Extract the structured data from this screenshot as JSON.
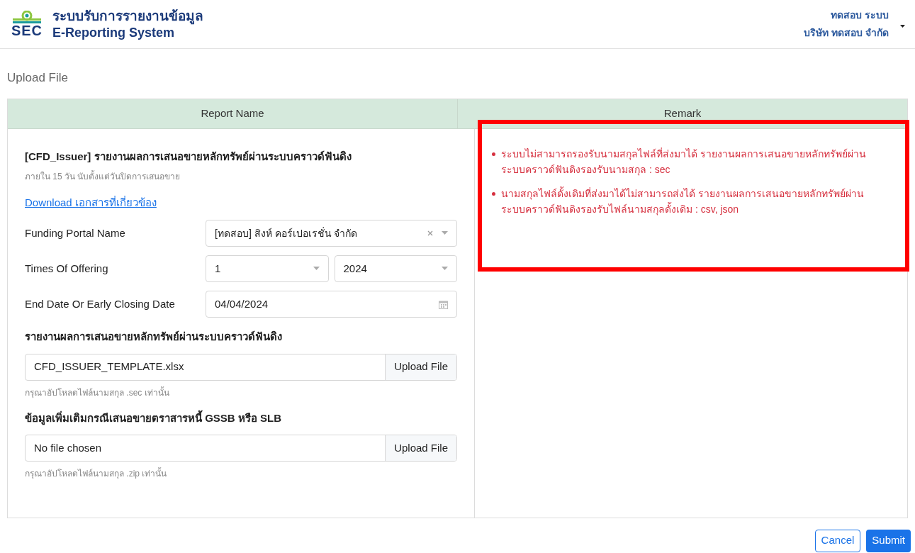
{
  "header": {
    "logo_text": "SEC",
    "title_th": "ระบบรับการรายงานข้อมูล",
    "title_en": "E-Reporting System",
    "user_name": "ทดสอบ ระบบ",
    "company": "บริษัท ทดสอบ จำกัด"
  },
  "page_title": "Upload File",
  "table": {
    "columns": [
      "Report Name",
      "Remark"
    ],
    "report": {
      "title": "[CFD_Issuer] รายงานผลการเสนอขายหลักทรัพย์ผ่านระบบคราวด์ฟันดิง",
      "subtitle": "ภายใน 15 วัน นับตั้งแต่วันปิดการเสนอขาย",
      "download_link": "Download เอกสารที่เกี่ยวข้อง",
      "fields": [
        {
          "kind": "select",
          "label": "Funding Portal Name",
          "value": "[ทดสอบ] สิงห์ คอร์เปอเรชั่น จำกัด",
          "clearable": true
        },
        {
          "kind": "select_pair",
          "label": "Times Of Offering",
          "values": [
            "1",
            "2024"
          ]
        },
        {
          "kind": "date",
          "label": "End Date Or Early Closing Date",
          "value": "04/04/2024"
        }
      ],
      "uploads": [
        {
          "label": "รายงานผลการเสนอขายหลักทรัพย์ผ่านระบบคราวด์ฟันดิง",
          "file": "CFD_ISSUER_TEMPLATE.xlsx",
          "button": "Upload File",
          "hint": "กรุณาอัปโหลดไฟล์นามสกุล .sec เท่านั้น"
        },
        {
          "label": "ข้อมูลเพิ่มเติมกรณีเสนอขายตราสารหนี้ GSSB หรือ SLB",
          "file": "No file chosen",
          "button": "Upload File",
          "hint": "กรุณาอัปโหลดไฟล์นามสกุล .zip เท่านั้น"
        }
      ]
    },
    "remarks": {
      "highlighted": true,
      "items": [
        "ระบบไม่สามารถรองรับนามสกุลไฟล์ที่ส่งมาได้ รายงานผลการเสนอขายหลักทรัพย์ผ่านระบบคราวด์ฟันดิงรองรับนามสกุล : sec",
        "นามสกุลไฟล์ดั้งเดิมที่ส่งมาได้ไม่สามารถส่งได้ รายงานผลการเสนอขายหลักทรัพย์ผ่านระบบคราวด์ฟันดิงรองรับไฟล์นามสกุลดั้งเดิม : csv, json"
      ]
    }
  },
  "buttons": [
    "Cancel",
    "Submit"
  ]
}
